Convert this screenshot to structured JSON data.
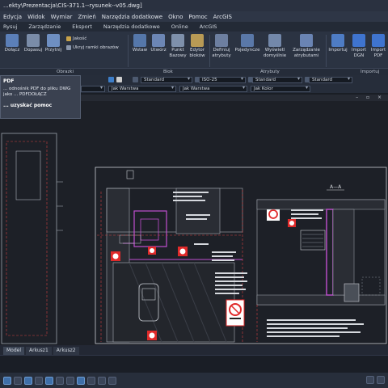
{
  "window": {
    "title": "...ekty\\Prezentacja\\CIS-371.1--rysunek--v05.dwg]"
  },
  "menu": [
    "Edycja",
    "Widok",
    "Wymiar",
    "Zmień",
    "Narzędzia dodatkowe",
    "Okno",
    "Pomoc",
    "ArcGIS"
  ],
  "ribbon_tabs": [
    "Rysuj",
    "Zarządzanie",
    "Eksport",
    "Narzędzia dodatkowe",
    "Online",
    "ArcGIS"
  ],
  "ribbon": {
    "dolacz": "Dołącz",
    "dopasuj": "Dopasuj",
    "przytnij": "Przytnij",
    "jakosc": "Jakość",
    "ukryj_ramki": "Ukryj ramki obrazów",
    "wstaw": "Wstaw",
    "utworz": "Utwórz",
    "punkt_bazowy": "Punkt\nBazowy",
    "edytor_blokow": "Edytor\nbloków",
    "definiuj_atrybuty": "Definiuj\natrybuty",
    "pojedyncze": "Pojedyncze",
    "wyswietl_domyslnie": "Wyświetl\ndomyślnie",
    "zarzadzanie_atrybutami": "Zarządzanie\natrybutami",
    "importuj": "Importuj",
    "import_dgn": "Import\nDGN",
    "import_pdf": "Import\nPDF"
  },
  "groups": {
    "obrazki": "Obrazki",
    "blok": "Blok",
    "atrybuty": "Atrybuty",
    "importuj": "Importuj"
  },
  "props": {
    "style1": "Standard",
    "dimstyle": "ISO-25",
    "style2": "Standard",
    "style3": "Standard",
    "linetype": "Jak Warstwa",
    "lineweight": "Jak Warstwa",
    "color": "Jak Kolor"
  },
  "tooltip": {
    "title": "PDF",
    "body": "... odnośnik PDF do pliku DWG jako ... PDFDOŁĄCZ",
    "help": "... uzyskać pomoc"
  },
  "drawing": {
    "section_label": "A—A"
  },
  "layout_tabs": [
    "Model",
    "Arkusz1",
    "Arkusz2"
  ],
  "colors": {
    "accent": "#3f6fa8",
    "canvas": "#1d2027",
    "magenta": "#c04fd0",
    "red": "#e02a2a"
  }
}
